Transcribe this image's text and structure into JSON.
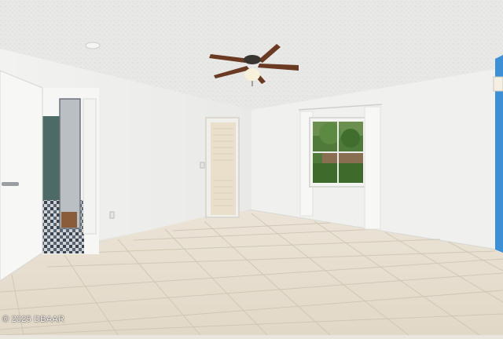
{
  "photo": {
    "subject": "empty-room-interior",
    "watermark": "© 2025 DBAAR"
  }
}
